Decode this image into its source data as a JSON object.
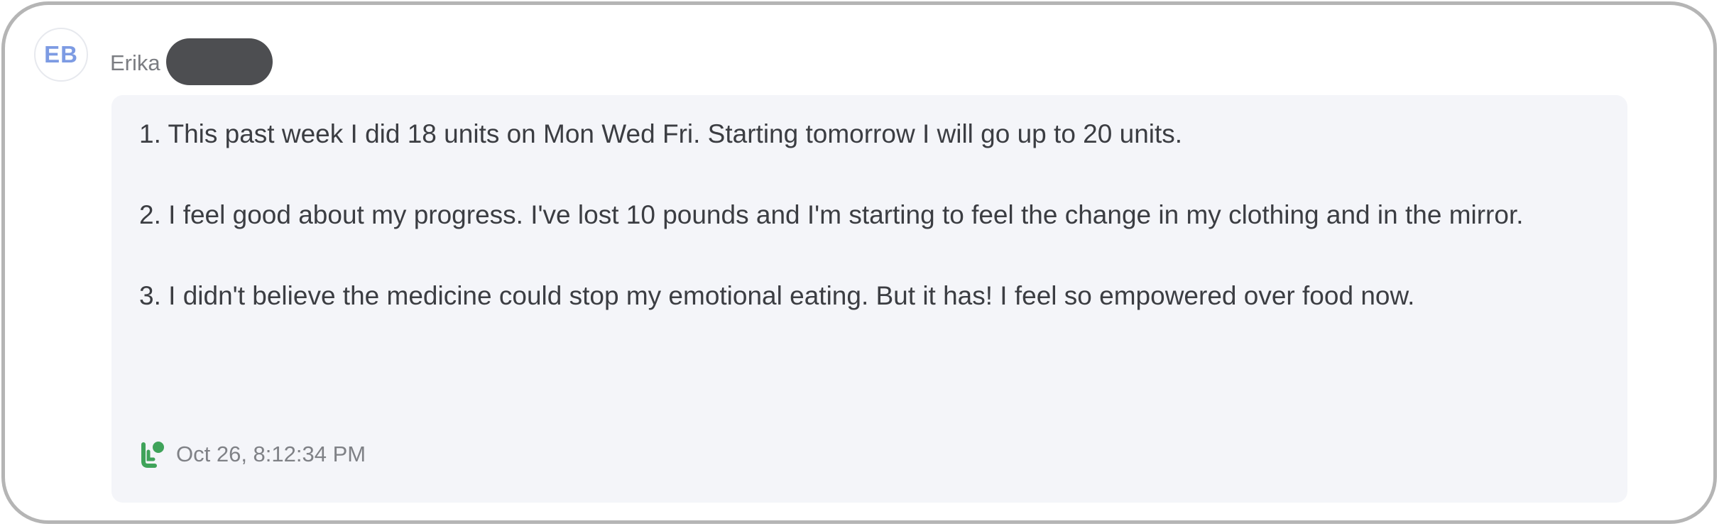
{
  "sender": {
    "initials": "EB",
    "name": "Erika"
  },
  "message": {
    "paragraphs": [
      "1. This past week I did 18 units on Mon Wed Fri. Starting tomorrow I will go up to 20 units.",
      "2. I feel good about my progress. I've lost 10 pounds and I'm starting to feel the change in my clothing and in the mirror.",
      "3. I didn't believe the medicine could stop my emotional eating. But it has! I feel so empowered over food now."
    ],
    "timestamp": "Oct 26, 8:12:34 PM",
    "status_icon": "delivered-status-icon"
  },
  "colors": {
    "avatar_text": "#7d9be3",
    "bubble_bg": "#f4f5f9",
    "status_green": "#3fa35a",
    "redaction": "#4d4e51"
  }
}
